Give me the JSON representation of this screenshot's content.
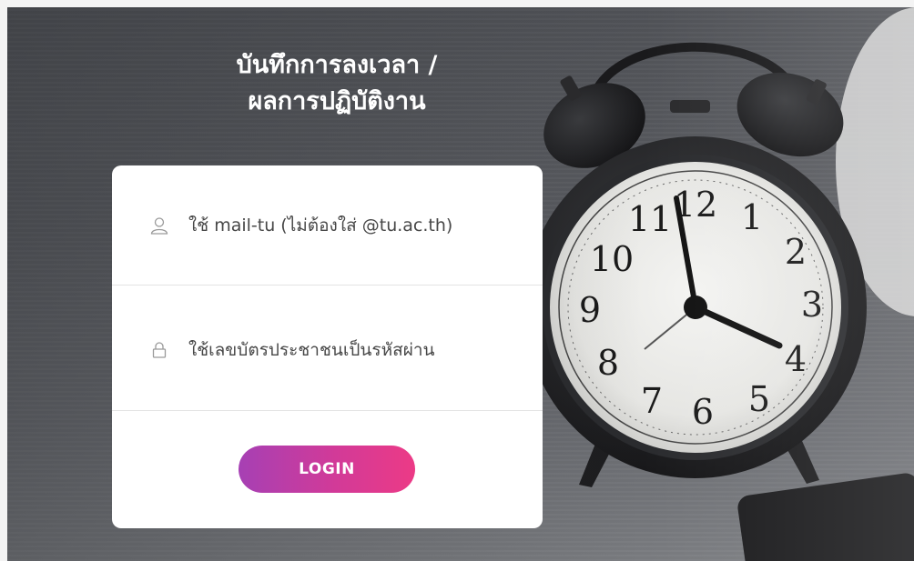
{
  "header": {
    "title_line1": "บันทึกการลงเวลา /",
    "title_line2": "ผลการปฏิบัติงาน"
  },
  "login_form": {
    "username": {
      "placeholder": "ใช้ mail-tu (ไม่ต้องใส่ @tu.ac.th)",
      "value": "",
      "icon": "user-icon"
    },
    "password": {
      "placeholder": "ใช้เลขบัตรประชาชนเป็นรหัสผ่าน",
      "value": "",
      "icon": "lock-icon"
    },
    "login_label": "LOGIN"
  },
  "background": {
    "image": "alarm-clock-photo",
    "clock_numerals": [
      "12",
      "1",
      "2",
      "3",
      "4",
      "5",
      "6",
      "7",
      "8",
      "9",
      "10",
      "11"
    ]
  },
  "colors": {
    "button_gradient_start": "#a640b4",
    "button_gradient_end": "#ec3a86",
    "card_background": "#ffffff",
    "title_text": "#ffffff"
  }
}
